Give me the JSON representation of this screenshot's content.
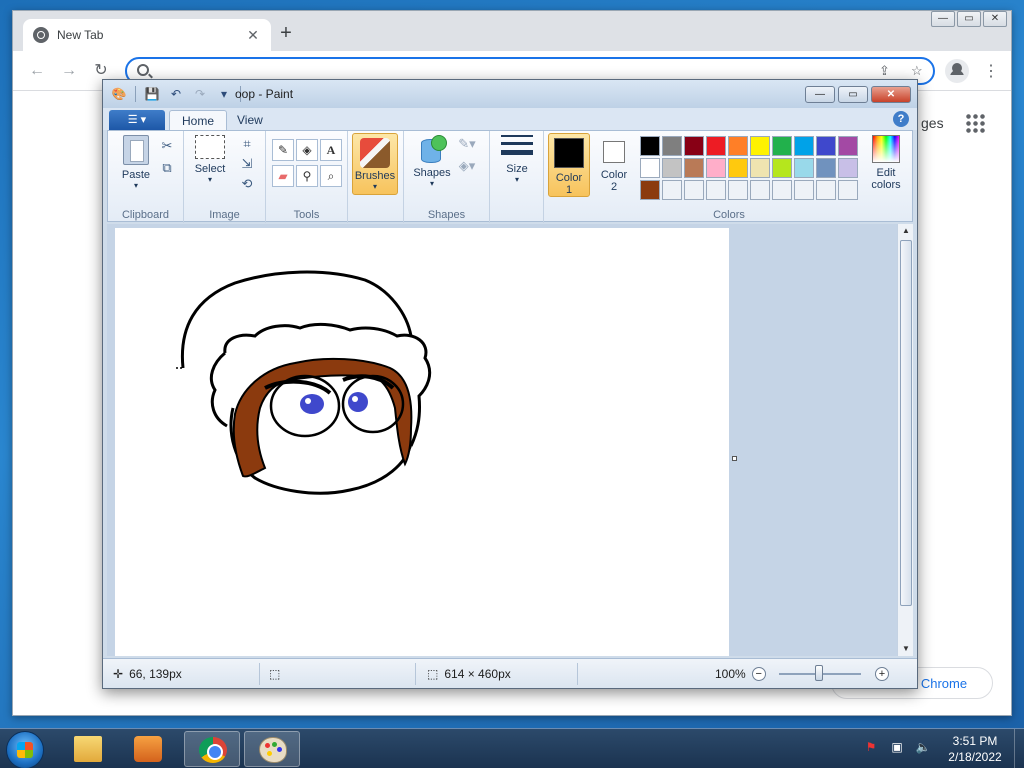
{
  "chrome": {
    "tab_title": "New Tab",
    "tab_close": "✕",
    "new_tab": "+",
    "omnibox_value": "",
    "content_partial_text": "ges",
    "customize_text": "e Chrome",
    "window_controls": {
      "minimize": "—",
      "maximize": "▭",
      "close": "✕"
    }
  },
  "paint": {
    "title": "oop - Paint",
    "tabs": {
      "home": "Home",
      "view": "View"
    },
    "groups": {
      "clipboard": "Clipboard",
      "image": "Image",
      "tools": "Tools",
      "shapes": "Shapes",
      "colors": "Colors"
    },
    "buttons": {
      "paste": "Paste",
      "select": "Select",
      "brushes": "Brushes",
      "shapes": "Shapes",
      "size": "Size",
      "color1_line1": "Color",
      "color1_line2": "1",
      "color2_line1": "Color",
      "color2_line2": "2",
      "edit_colors_line1": "Edit",
      "edit_colors_line2": "colors"
    },
    "color1": "#000000",
    "color2": "#ffffff",
    "palette": [
      "#000000",
      "#7f7f7f",
      "#880015",
      "#ed1c24",
      "#ff7f27",
      "#fff200",
      "#22b14c",
      "#00a2e8",
      "#3f48cc",
      "#a349a4",
      "#ffffff",
      "#c3c3c3",
      "#b97a57",
      "#ffaec9",
      "#ffc90e",
      "#efe4b0",
      "#b5e61d",
      "#99d9ea",
      "#7092be",
      "#c8bfe7",
      "#8b3a0e",
      "#eef2f7",
      "#eef2f7",
      "#eef2f7",
      "#eef2f7",
      "#eef2f7",
      "#eef2f7",
      "#eef2f7",
      "#eef2f7",
      "#eef2f7"
    ],
    "status": {
      "cursor_pos": "66, 139px",
      "canvas_size": "614 × 460px",
      "zoom": "100%"
    }
  },
  "taskbar": {
    "time": "3:51 PM",
    "date": "2/18/2022"
  }
}
